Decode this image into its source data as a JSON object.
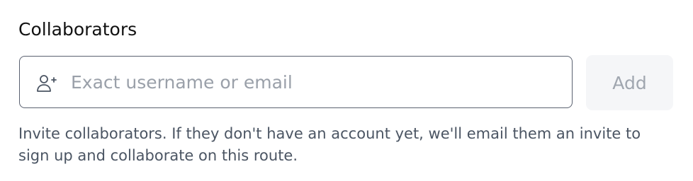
{
  "section": {
    "title": "Collaborators"
  },
  "invite_input": {
    "value": "",
    "placeholder": "Exact username or email",
    "icon": "user-plus-icon"
  },
  "add_button": {
    "label": "Add",
    "state": "disabled"
  },
  "help_text": "Invite collaborators. If they don't have an account yet, we'll email them an invite to sign up and collaborate on this route.",
  "colors": {
    "input_border": "#5a6170",
    "placeholder": "#9aa0a9",
    "button_bg": "#f5f6f8",
    "button_text": "#a0a6af",
    "help_text": "#4b5563"
  }
}
